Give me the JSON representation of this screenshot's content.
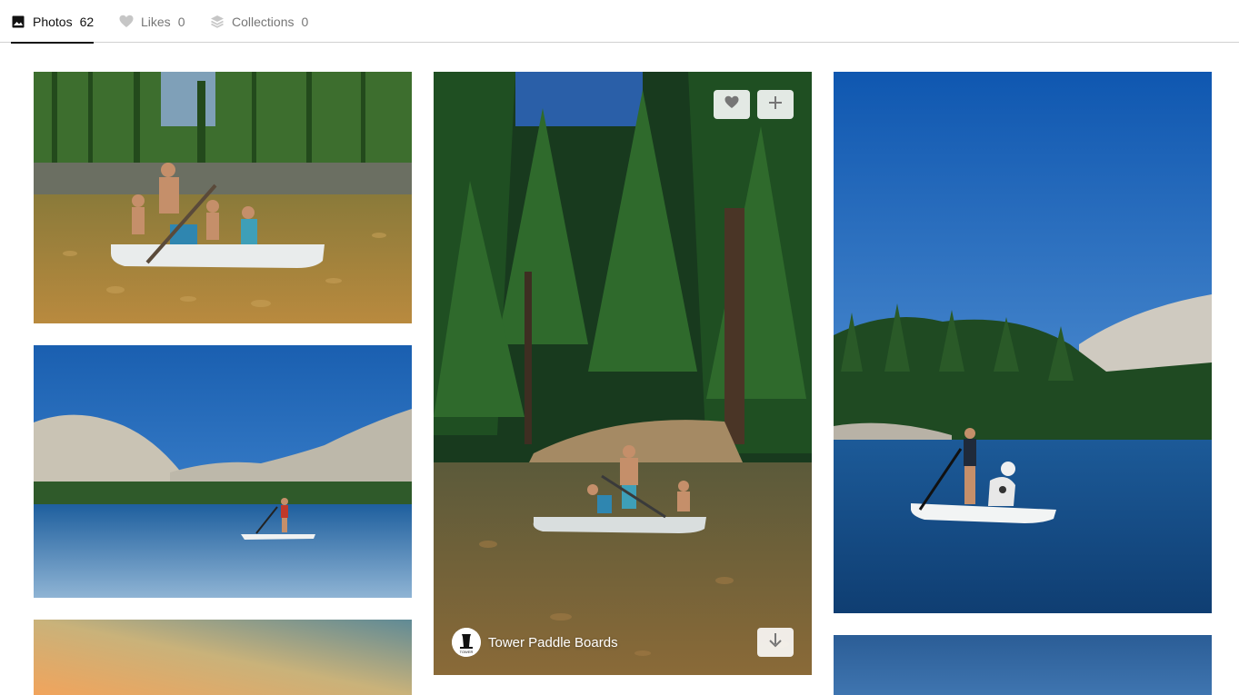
{
  "tabs": [
    {
      "label": "Photos",
      "count": "62",
      "icon": "image-icon",
      "active": true
    },
    {
      "label": "Likes",
      "count": "0",
      "icon": "heart-icon",
      "active": false
    },
    {
      "label": "Collections",
      "count": "0",
      "icon": "stack-icon",
      "active": false
    }
  ],
  "photos": [
    {
      "scene": "family on paddle board in clear forest river",
      "column": 1
    },
    {
      "scene": "paddle boarder on mountain lake with granite domes",
      "column": 1
    },
    {
      "scene": "sunset sky (partially visible)",
      "column": 1
    },
    {
      "scene": "family paddle boarding under tall pines",
      "column": 2
    },
    {
      "scene": "woman and dog on paddle board on alpine lake",
      "column": 3
    },
    {
      "scene": "blue sky (partially visible)",
      "column": 3
    }
  ],
  "hovered_card": {
    "author_name": "Tower Paddle Boards",
    "avatar_text": "TOWER",
    "like_icon": "heart-icon",
    "add_icon": "plus-icon",
    "download_icon": "arrow-down-icon"
  },
  "colors": {
    "active_tab": "#111111",
    "inactive_tab": "#767676",
    "divider": "#d1d1d1",
    "button_bg": "#f2f2f2"
  }
}
